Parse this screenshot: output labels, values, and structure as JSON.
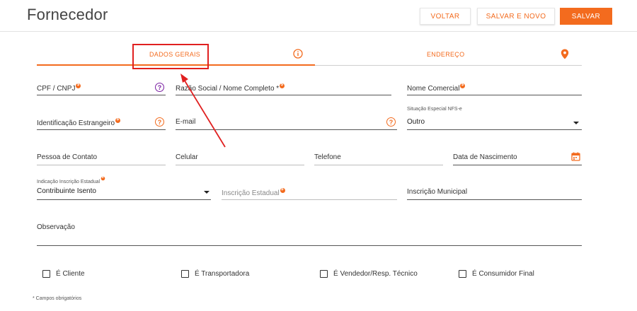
{
  "header": {
    "title": "Fornecedor",
    "buttons": {
      "voltar": "VOLTAR",
      "salvar_novo": "SALVAR E NOVO",
      "salvar": "SALVAR"
    }
  },
  "tabs": [
    {
      "label": "DADOS GERAIS",
      "icon": "info-icon"
    },
    {
      "label": "ENDEREÇO",
      "icon": "location-pin-icon"
    }
  ],
  "fields": {
    "cpf_cnpj": "CPF / CNPJ",
    "razao_social": "Razão Social / Nome Completo *",
    "nome_comercial": "Nome Comercial",
    "identificacao_estrangeiro": "Identificação Estrangeiro",
    "email": "E-mail",
    "situacao_nfse_label": "Situação Especial NFS-e",
    "situacao_nfse_value": "Outro",
    "pessoa_contato": "Pessoa de Contato",
    "celular": "Celular",
    "telefone": "Telefone",
    "data_nascimento": "Data de Nascimento",
    "indicacao_ie_label": "Indicação Inscrição Estadual",
    "indicacao_ie_value": "Contribuinte Isento",
    "inscricao_estadual": "Inscrição Estadual",
    "inscricao_municipal": "Inscrição Municipal",
    "observacao": "Observação"
  },
  "checkboxes": [
    "É Cliente",
    "É Transportadora",
    "É Vendedor/Resp. Técnico",
    "É Consumidor Final"
  ],
  "footnote": "* Campos obrigatórios",
  "colors": {
    "accent": "#f36b1e",
    "help_purple": "#7a1fa2",
    "annotation": "#e02020"
  }
}
